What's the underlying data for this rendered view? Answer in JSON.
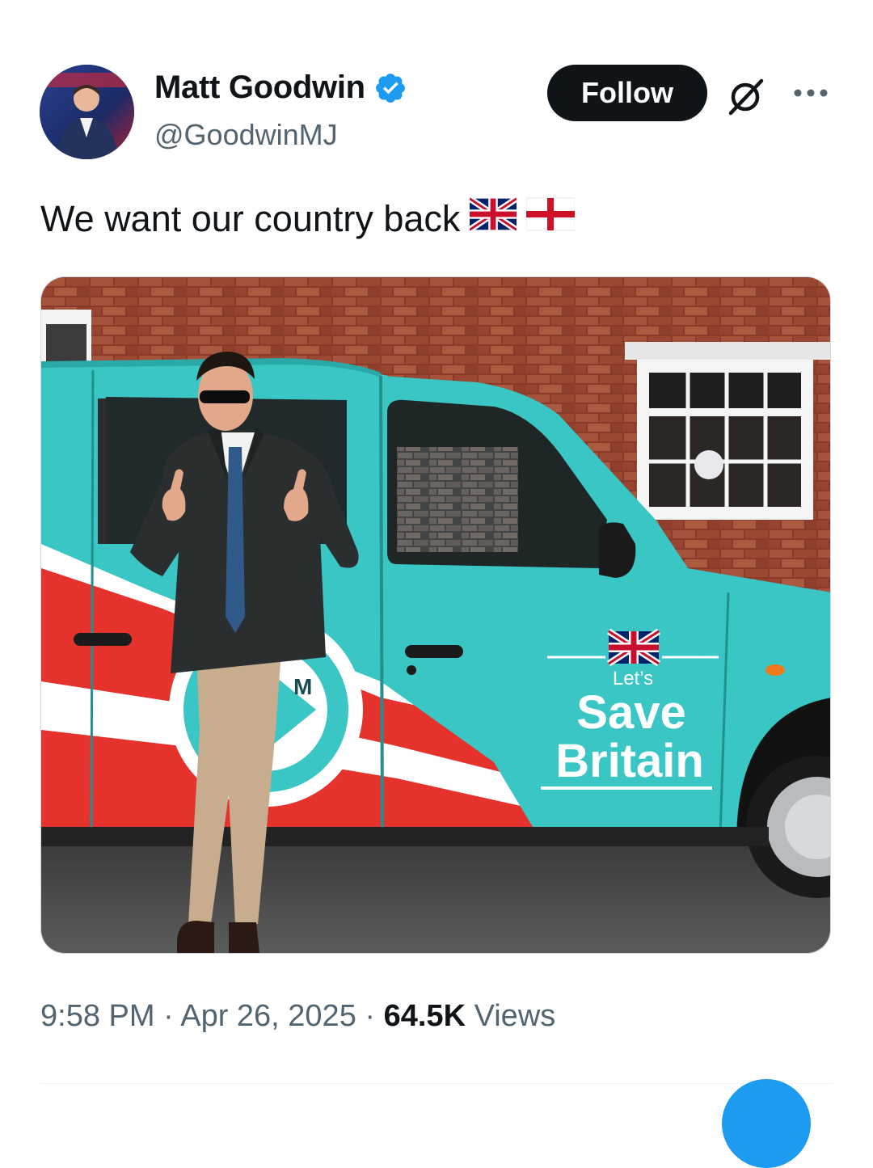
{
  "author": {
    "display_name": "Matt Goodwin",
    "handle": "@GoodwinMJ",
    "verified": true,
    "verified_color": "#1d9bf0"
  },
  "actions": {
    "follow_label": "Follow",
    "grok_icon": "grok-icon",
    "more_icon": "more-options-icon"
  },
  "tweet": {
    "text": "We want our country back",
    "emojis": [
      "union-jack-flag",
      "england-flag"
    ]
  },
  "media": {
    "taxi_text": {
      "line1": "Let’s",
      "line2": "Save",
      "line3": "Britain",
      "door_fragment": "M"
    }
  },
  "meta": {
    "time": "9:58 PM",
    "separator": "·",
    "date": "Apr 26, 2025",
    "views_count": "64.5K",
    "views_label": "Views"
  },
  "colors": {
    "accent": "#1d9bf0",
    "taxi_turquoise": "#39c6c4",
    "taxi_red": "#e5322d",
    "brick": "#9c4a32"
  }
}
